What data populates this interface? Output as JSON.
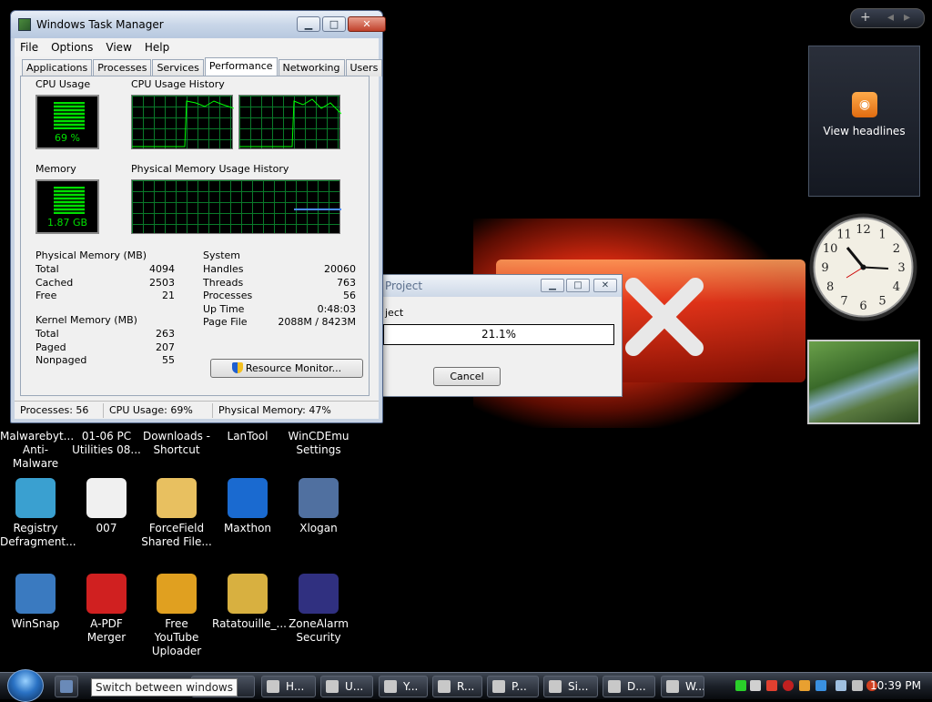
{
  "taskmgr": {
    "title": "Windows Task Manager",
    "minimize_icon": "minimize-icon",
    "menu": [
      "File",
      "Options",
      "View",
      "Help"
    ],
    "tabs": [
      "Applications",
      "Processes",
      "Services",
      "Performance",
      "Networking",
      "Users"
    ],
    "active_tab": "Performance",
    "cpu_usage_label": "CPU Usage",
    "cpu_usage_value": "69 %",
    "cpu_history_label": "CPU Usage History",
    "memory_label": "Memory",
    "memory_value": "1.87 GB",
    "mem_history_label": "Physical Memory Usage History",
    "physical_memory": {
      "heading": "Physical Memory (MB)",
      "rows": [
        {
          "label": "Total",
          "value": "4094"
        },
        {
          "label": "Cached",
          "value": "2503"
        },
        {
          "label": "Free",
          "value": "21"
        }
      ]
    },
    "kernel_memory": {
      "heading": "Kernel Memory (MB)",
      "rows": [
        {
          "label": "Total",
          "value": "263"
        },
        {
          "label": "Paged",
          "value": "207"
        },
        {
          "label": "Nonpaged",
          "value": "55"
        }
      ]
    },
    "system": {
      "heading": "System",
      "rows": [
        {
          "label": "Handles",
          "value": "20060"
        },
        {
          "label": "Threads",
          "value": "763"
        },
        {
          "label": "Processes",
          "value": "56"
        },
        {
          "label": "Up Time",
          "value": "0:48:03"
        },
        {
          "label": "Page File",
          "value": "2088M / 8423M"
        }
      ]
    },
    "resource_monitor_label": "Resource Monitor...",
    "status": {
      "processes": "Processes: 56",
      "cpu": "CPU Usage: 69%",
      "memory": "Physical Memory: 47%"
    }
  },
  "progress_dialog": {
    "title": "Project",
    "subtitle": "ject",
    "progress_text": "21.1%",
    "progress_fraction": 0.211,
    "cancel_label": "Cancel"
  },
  "gadgets": {
    "feed_text": "View headlines",
    "add_icon": "plus-icon",
    "clock_hour_numbers": [
      "12",
      "1",
      "2",
      "3",
      "4",
      "5",
      "6",
      "7",
      "8",
      "9",
      "10",
      "11"
    ]
  },
  "desktop_icons": [
    {
      "line1": "Malwarebyt...",
      "line2": "Anti-Malware",
      "icon": "malwarebytes-icon"
    },
    {
      "line1": "01-06 PC",
      "line2": "Utilities 08...",
      "icon": "document-icon"
    },
    {
      "line1": "Downloads -",
      "line2": "Shortcut",
      "icon": "folder-shortcut-icon"
    },
    {
      "line1": "LanTool",
      "line2": "",
      "icon": "lantool-icon"
    },
    {
      "line1": "WinCDEmu",
      "line2": "Settings",
      "icon": "wincdemu-icon"
    },
    {
      "line1": "Registry",
      "line2": "Defragment...",
      "icon": "registry-icon"
    },
    {
      "line1": "007",
      "line2": "",
      "icon": "mp3-file-icon"
    },
    {
      "line1": "ForceField",
      "line2": "Shared File...",
      "icon": "folder-icon"
    },
    {
      "line1": "Maxthon",
      "line2": "",
      "icon": "maxthon-icon"
    },
    {
      "line1": "Xlogan",
      "line2": "",
      "icon": "xlogan-icon"
    },
    {
      "line1": "WinSnap",
      "line2": "",
      "icon": "winsnap-icon"
    },
    {
      "line1": "A-PDF",
      "line2": "Merger",
      "icon": "pdf-icon"
    },
    {
      "line1": "Free YouTube",
      "line2": "Uploader",
      "icon": "rocket-icon"
    },
    {
      "line1": "Ratatouille_...",
      "line2": "",
      "icon": "zip-folder-icon"
    },
    {
      "line1": "ZoneAlarm",
      "line2": "Security",
      "icon": "zonealarm-icon"
    }
  ],
  "taskbar": {
    "tooltip": "Switch between windows",
    "buttons": [
      "V...",
      "H...",
      "U...",
      "Y...",
      "R...",
      "P...",
      "Si...",
      "D...",
      "W..."
    ],
    "clock": "10:39 PM"
  }
}
